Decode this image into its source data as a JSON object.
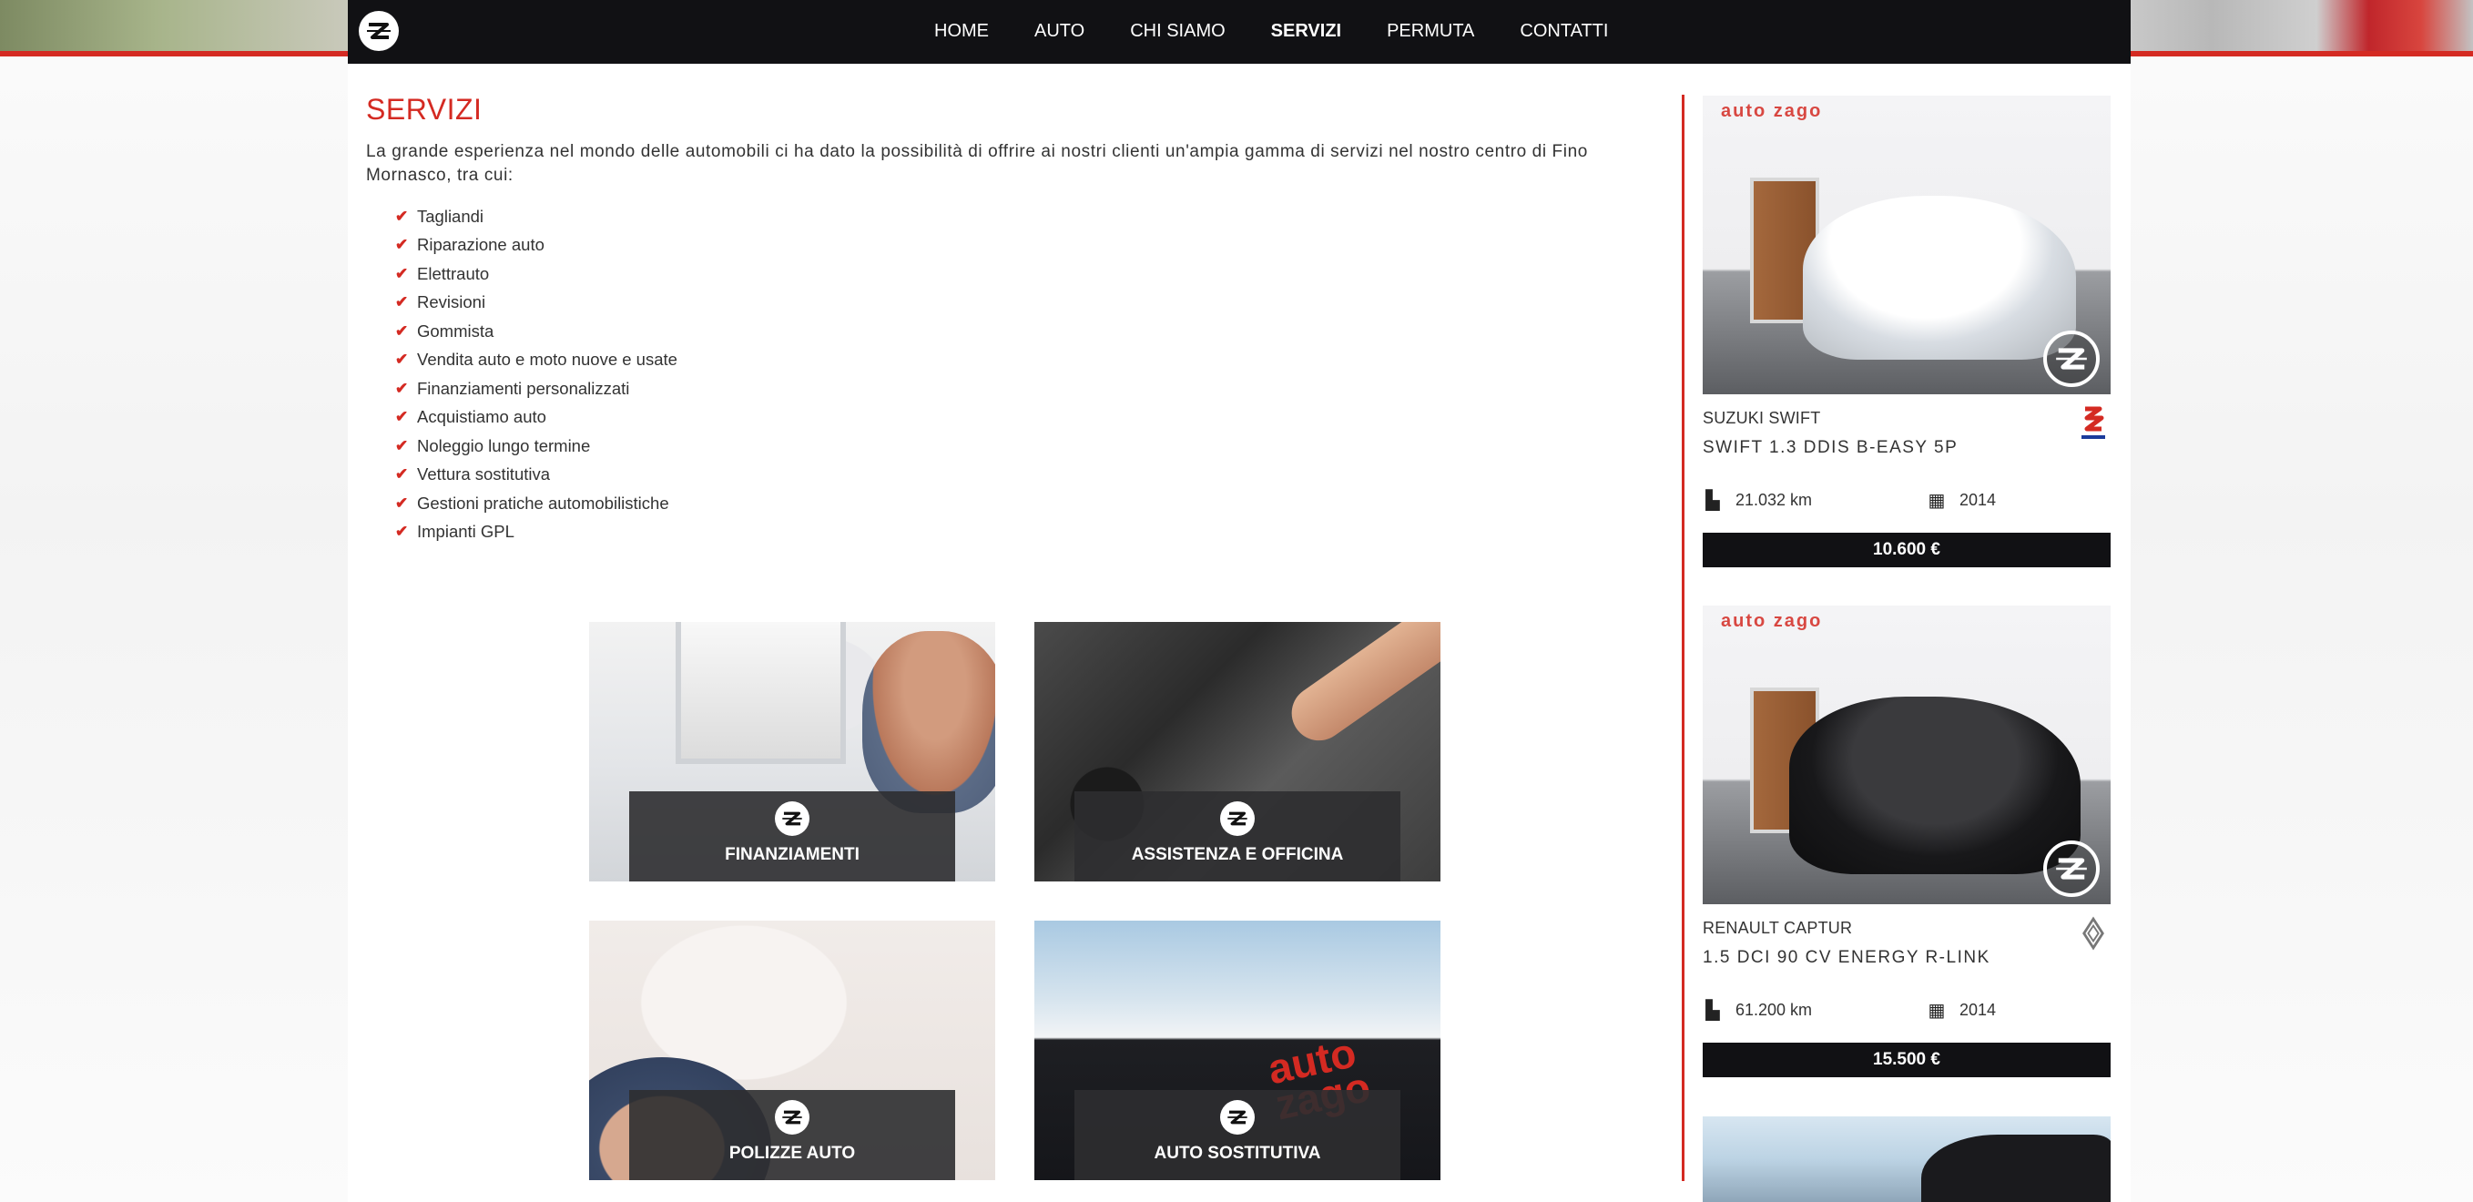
{
  "colors": {
    "accent": "#d42a22",
    "navbar": "#111114",
    "price_bar": "#111114"
  },
  "nav": {
    "logo_icon": "autozago-logo",
    "items": [
      {
        "label": "HOME",
        "active": false
      },
      {
        "label": "AUTO",
        "active": false
      },
      {
        "label": "CHI SIAMO",
        "active": false
      },
      {
        "label": "SERVIZI",
        "active": true
      },
      {
        "label": "PERMUTA",
        "active": false
      },
      {
        "label": "CONTATTI",
        "active": false
      }
    ]
  },
  "main": {
    "title": "SERVIZI",
    "intro": "La grande esperienza nel mondo delle automobili ci ha dato la possibilità di offrire ai nostri clienti un'ampia gamma di servizi nel nostro centro di Fino Mornasco, tra cui:",
    "services": [
      "Tagliandi",
      "Riparazione auto",
      "Elettrauto",
      "Revisioni",
      "Gommista",
      "Vendita auto e moto nuove e usate",
      "Finanziamenti personalizzati",
      "Acquistiamo auto",
      "Noleggio lungo termine",
      "Vettura sostitutiva",
      "Gestioni pratiche automobilistiche",
      "Impianti GPL"
    ],
    "check_icon": "checkmark-icon",
    "tiles": [
      {
        "label": "FINANZIAMENTI"
      },
      {
        "label": "ASSISTENZA E OFFICINA"
      },
      {
        "label": "POLIZZE AUTO"
      },
      {
        "label": "AUTO SOSTITUTIVA"
      }
    ]
  },
  "sidebar": {
    "cars": [
      {
        "make": "SUZUKI SWIFT",
        "model": "SWIFT 1.3 DDIS B-EASY 5P",
        "km": "21.032 km",
        "year": "2014",
        "price": "10.600 €",
        "brand_icon": "suzuki-logo-icon",
        "wall_text": "auto zago"
      },
      {
        "make": "RENAULT CAPTUR",
        "model": "1.5 DCI 90 CV ENERGY R-LINK",
        "km": "61.200 km",
        "year": "2014",
        "price": "15.500 €",
        "brand_icon": "renault-logo-icon",
        "wall_text": "auto zago"
      }
    ],
    "km_icon": "road-icon",
    "year_icon": "calendar-icon"
  }
}
